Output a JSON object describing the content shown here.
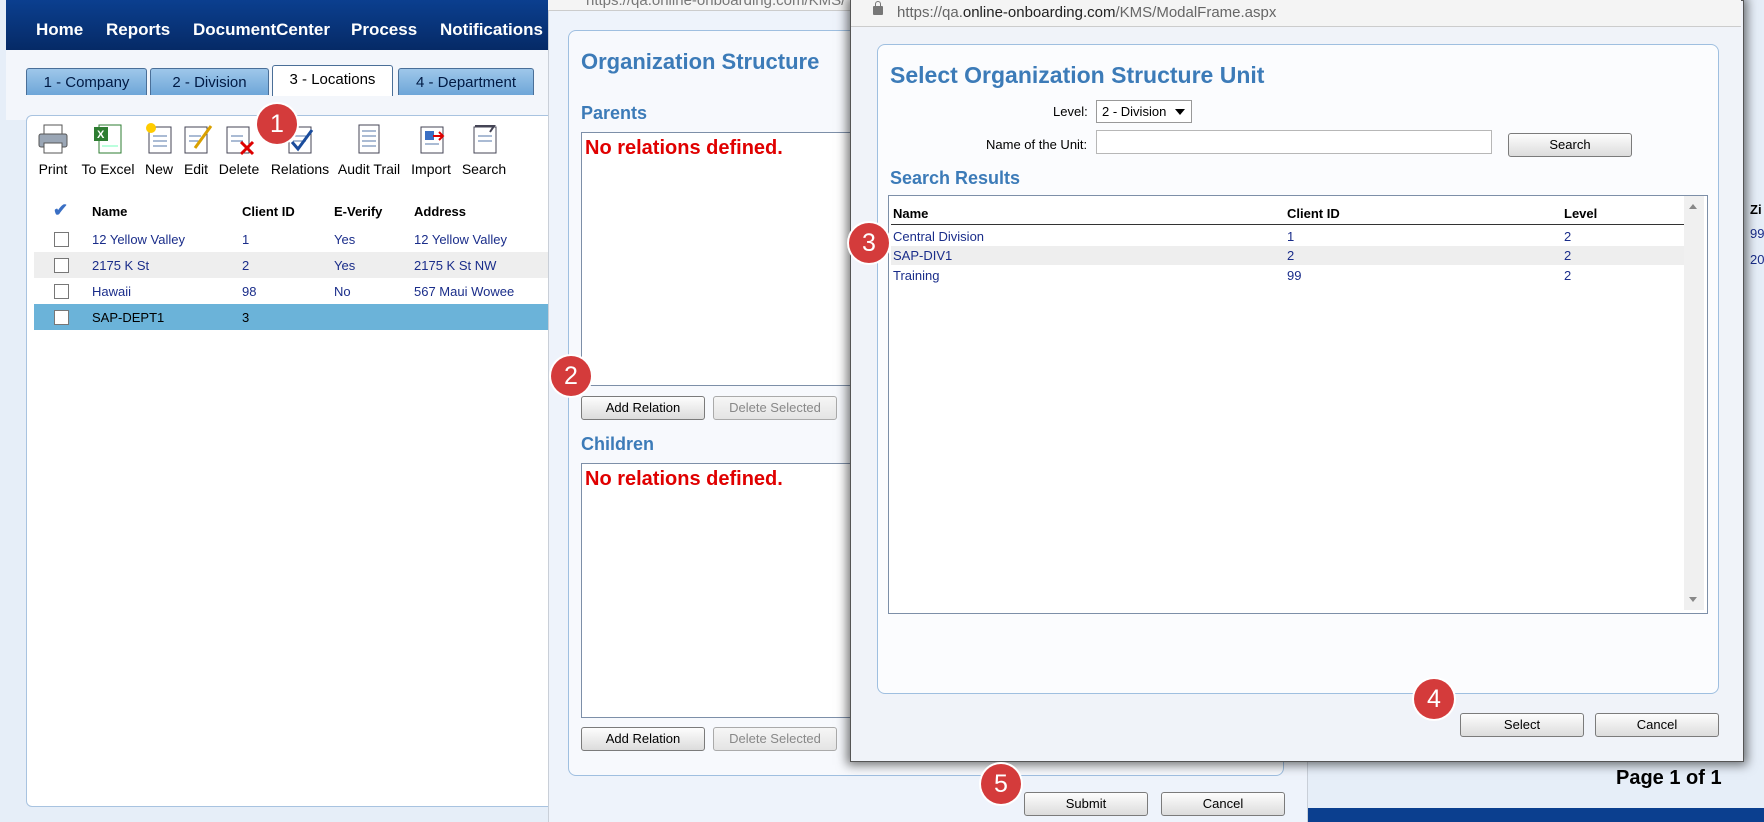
{
  "nav": {
    "items": [
      "Home",
      "Reports",
      "DocumentCenter",
      "Process",
      "Notifications"
    ]
  },
  "tabs": [
    "1 - Company",
    "2 - Division",
    "3 - Locations",
    "4 - Department"
  ],
  "toolbar": {
    "items": [
      "Print",
      "To Excel",
      "New",
      "Edit",
      "Delete",
      "Relations",
      "Audit Trail",
      "Import",
      "Search"
    ]
  },
  "locations_grid": {
    "headers": [
      "Name",
      "Client ID",
      "E-Verify",
      "Address"
    ],
    "rows": [
      {
        "name": "12 Yellow Valley",
        "client_id": "1",
        "everify": "Yes",
        "address": "12 Yellow Valley"
      },
      {
        "name": "2175 K St",
        "client_id": "2",
        "everify": "Yes",
        "address": "2175 K St NW"
      },
      {
        "name": "Hawaii",
        "client_id": "98",
        "everify": "No",
        "address": "567 Maui Wowee"
      },
      {
        "name": "SAP-DEPT1",
        "client_id": "3",
        "everify": "",
        "address": ""
      }
    ]
  },
  "org_dialog": {
    "url": "https://qa.online-onboarding.com/KMS/",
    "title": "Organization Structure",
    "parents_label": "Parents",
    "children_label": "Children",
    "no_relations": "No relations defined.",
    "add_relation": "Add Relation",
    "delete_selected": "Delete Selected",
    "submit": "Submit",
    "cancel": "Cancel"
  },
  "select_modal": {
    "url_prefix": "https://qa.",
    "url_domain": "online-onboarding.com",
    "url_path": "/KMS/ModalFrame.aspx",
    "title": "Select Organization Structure Unit",
    "level_label": "Level:",
    "level_value": "2 - Division",
    "unit_label": "Name of the Unit:",
    "unit_value": "",
    "search_button": "Search",
    "results_label": "Search Results",
    "headers": [
      "Name",
      "Client ID",
      "Level"
    ],
    "rows": [
      {
        "name": "Central Division",
        "client_id": "1",
        "level": "2"
      },
      {
        "name": "SAP-DIV1",
        "client_id": "2",
        "level": "2"
      },
      {
        "name": "Training",
        "client_id": "99",
        "level": "2"
      }
    ],
    "select_button": "Select",
    "cancel_button": "Cancel"
  },
  "badges": [
    "1",
    "2",
    "3",
    "4",
    "5"
  ],
  "right_side": {
    "col_label": "Zi",
    "row_vals": [
      "99",
      "20"
    ],
    "paging": "Page 1 of 1"
  },
  "colors": {
    "nav_bg": "#0b3f8f",
    "heading_blue": "#3c7bb8",
    "error_red": "#e00000",
    "selected_row": "#6bb3d9",
    "badge_red": "#d43b3b"
  }
}
